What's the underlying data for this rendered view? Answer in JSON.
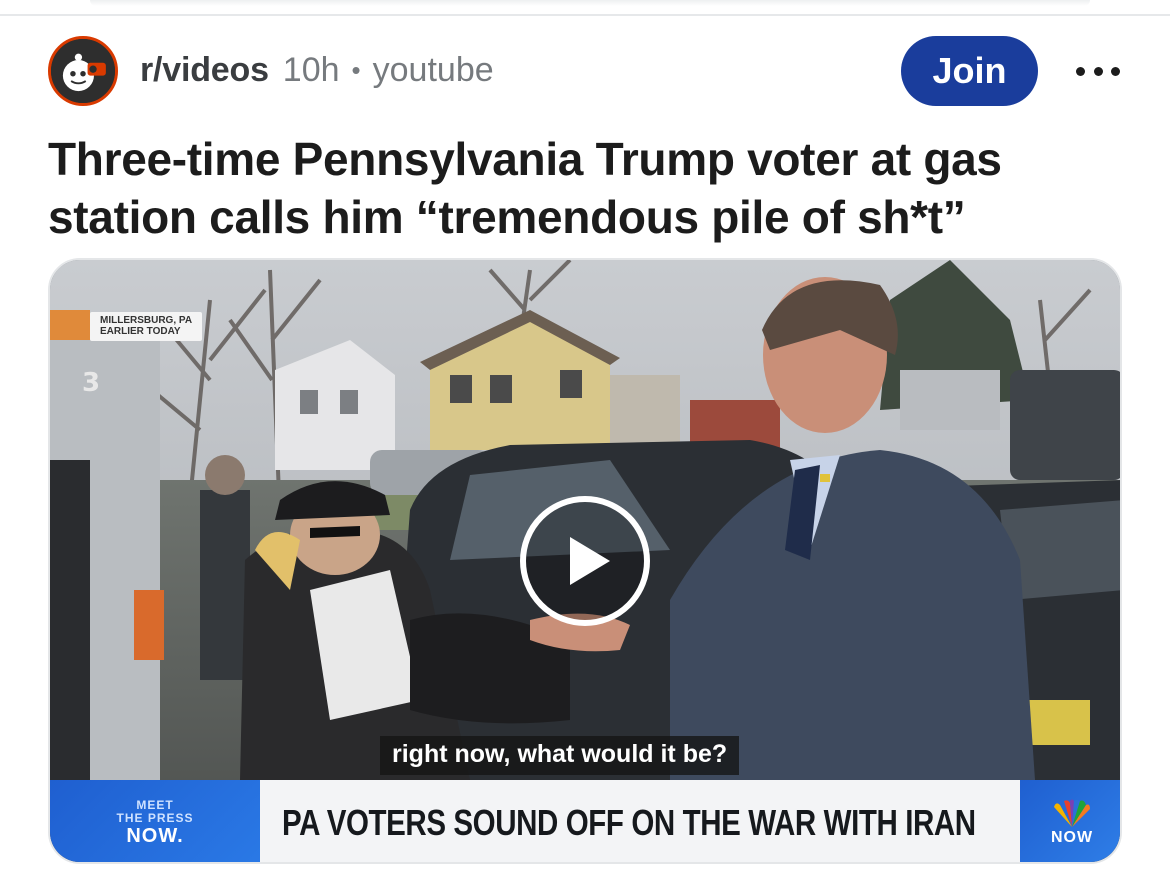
{
  "post": {
    "subreddit": "r/videos",
    "time": "10h",
    "separator": "•",
    "domain": "youtube",
    "join_label": "Join",
    "title": "Three-time Pennsylvania Trump voter at gas station calls him “tremendous pile of sh*t”"
  },
  "video": {
    "location_line1": "MILLERSBURG, PA",
    "location_line2": "EARLIER TODAY",
    "pump_number": "3",
    "caption": "right now, what would it be?",
    "lower_third": {
      "brand_line1": "MEET",
      "brand_line2": "THE PRESS",
      "brand_line3": "NOW.",
      "headline": "PA VOTERS SOUND OFF ON THE WAR WITH IRAN",
      "network_label": "NOW"
    }
  },
  "colors": {
    "join_button": "#1a3d9c",
    "lower_third_blue": "#2a79e6",
    "avatar_ring": "#d93a00"
  },
  "icons": {
    "avatar": "subreddit-avatar-icon",
    "more": "more-options-icon",
    "play": "play-icon",
    "network": "peacock-icon"
  }
}
